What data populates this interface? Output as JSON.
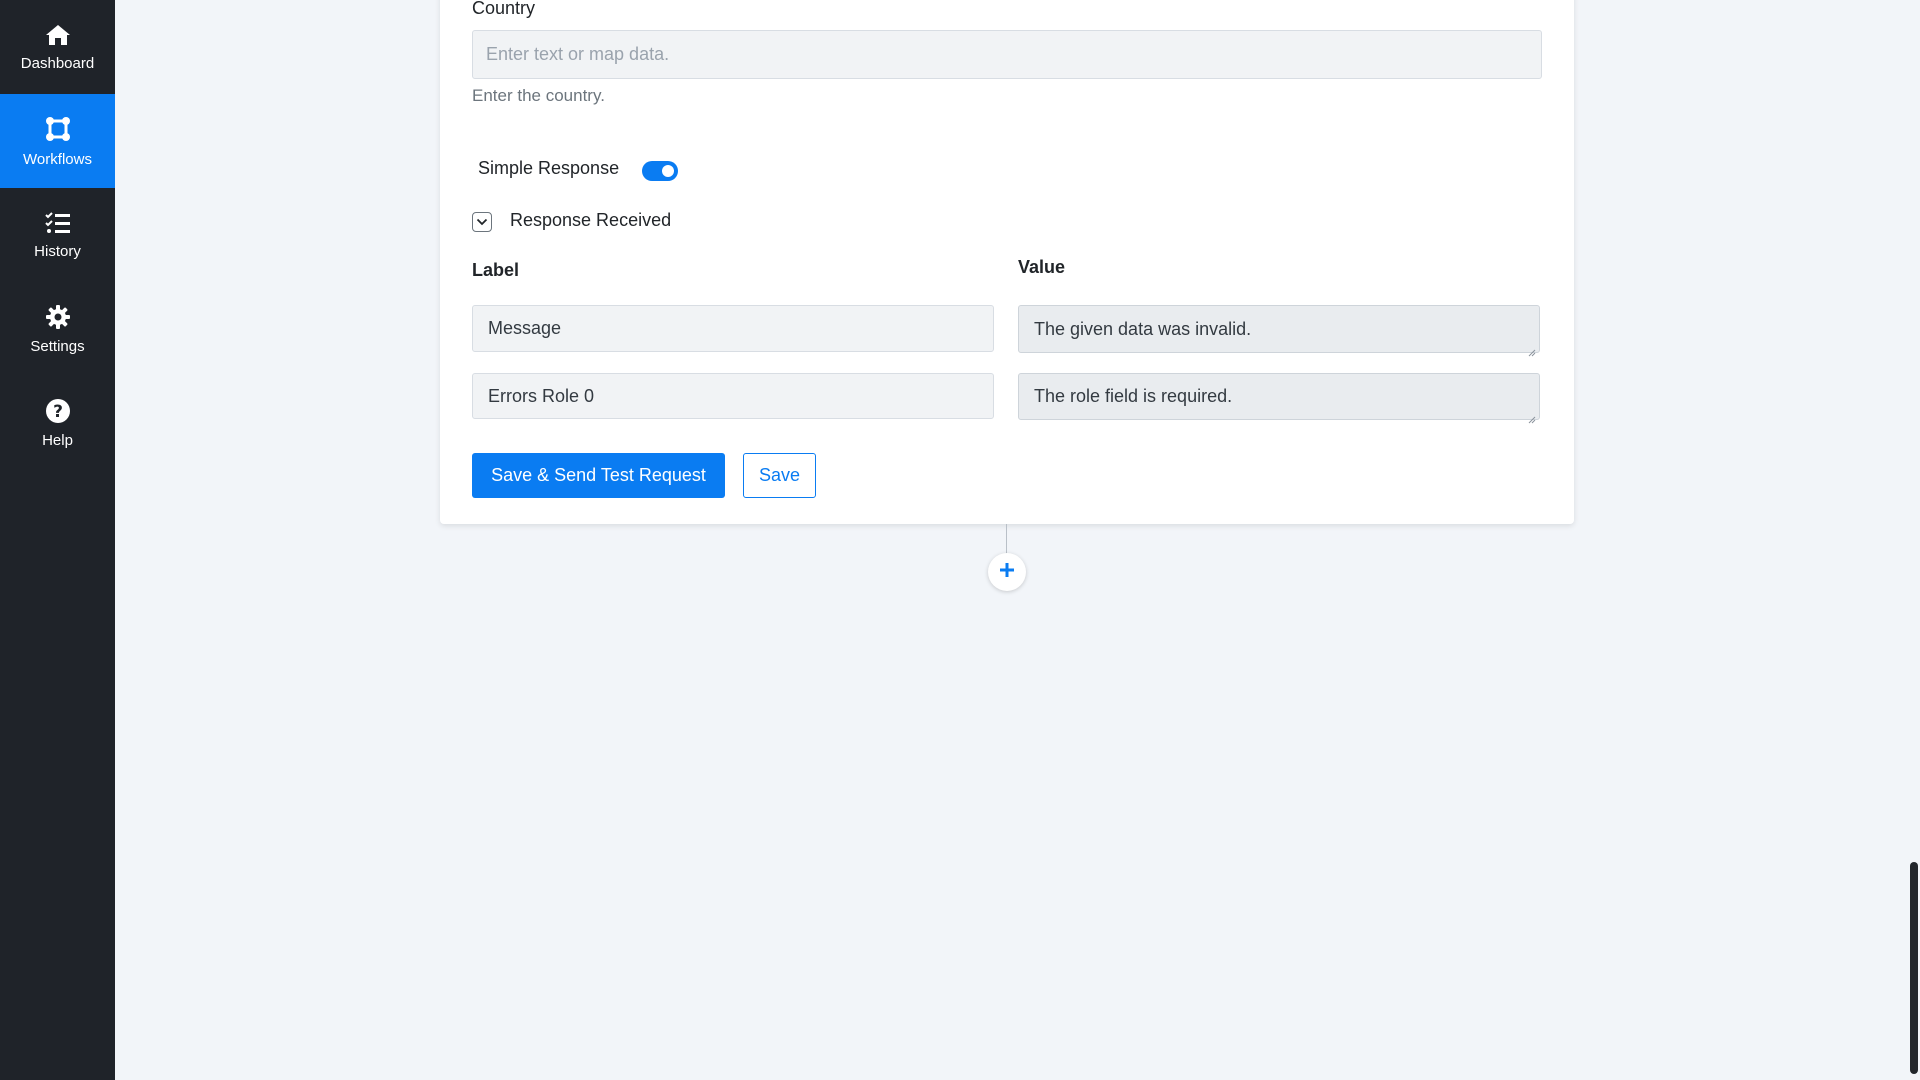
{
  "sidebar": {
    "items": [
      {
        "label": "Dashboard",
        "icon": "home-icon",
        "active": false
      },
      {
        "label": "Workflows",
        "icon": "workflows-icon",
        "active": true
      },
      {
        "label": "History",
        "icon": "history-icon",
        "active": false
      },
      {
        "label": "Settings",
        "icon": "gear-icon",
        "active": false
      },
      {
        "label": "Help",
        "icon": "help-icon",
        "active": false
      }
    ]
  },
  "form": {
    "country": {
      "label": "Country",
      "value": "",
      "placeholder": "Enter text or map data.",
      "help": "Enter the country."
    },
    "simple_response": {
      "label": "Simple Response",
      "enabled": true
    },
    "response_received": {
      "label": "Response Received",
      "expanded": true
    },
    "mapping": {
      "label_header": "Label",
      "value_header": "Value",
      "rows": [
        {
          "label": "Message",
          "value": "The given data was invalid."
        },
        {
          "label": "Errors Role 0",
          "value": "The role field is required."
        }
      ]
    },
    "buttons": {
      "save_send": "Save & Send Test Request",
      "save": "Save"
    }
  },
  "colors": {
    "accent": "#0a7cf2",
    "sidebar_bg": "#1f2329",
    "page_bg": "#f2f5f9"
  }
}
